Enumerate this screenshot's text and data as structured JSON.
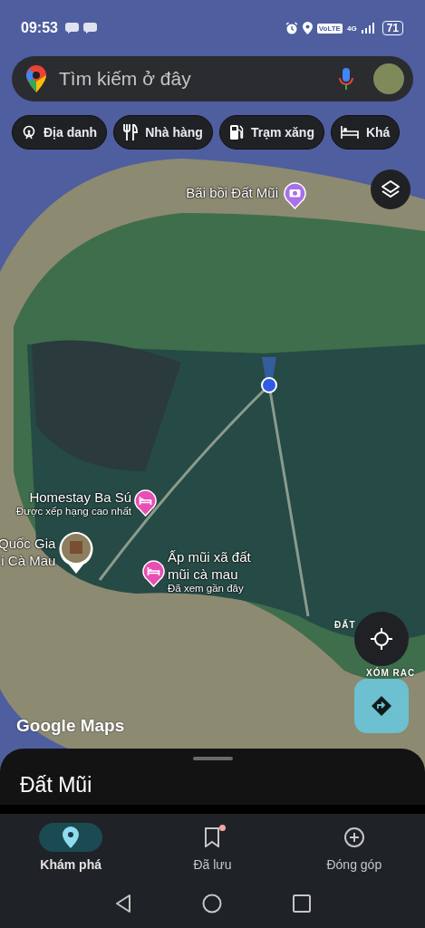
{
  "status_bar": {
    "time": "09:53",
    "network_badge": "VoLTE",
    "network_type": "4G",
    "battery": "71"
  },
  "search": {
    "placeholder": "Tìm kiếm ở đây"
  },
  "chips": [
    {
      "label": "Địa danh",
      "kind": "landmark"
    },
    {
      "label": "Nhà hàng",
      "kind": "restaurant"
    },
    {
      "label": "Trạm xăng",
      "kind": "gas"
    },
    {
      "label": "Khá",
      "kind": "hotel"
    }
  ],
  "map": {
    "places": [
      {
        "lines": [
          "Bãi bồi Đất Mũi"
        ],
        "kind": "camera",
        "color": "#a970e8"
      },
      {
        "lines": [
          "Homestay Ba Sú"
        ],
        "subtitle": "Được xếp hạng cao nhất",
        "kind": "hotel",
        "color": "#e84fb4"
      },
      {
        "lines": [
          "Quốc Gia",
          "i Cà Mau"
        ],
        "kind": "photo"
      },
      {
        "lines": [
          "Ấp mũi xã đất",
          "mũi cà mau"
        ],
        "subtitle": "Đã xem gần đây",
        "kind": "hotel",
        "color": "#e84fb4"
      }
    ],
    "area_labels": [
      "ĐẤT",
      "XÓM RAC"
    ],
    "logo": "Google Maps"
  },
  "sheet": {
    "title": "Đất Mũi"
  },
  "nav": [
    {
      "label": "Khám phá",
      "kind": "explore",
      "selected": true,
      "badge": false
    },
    {
      "label": "Đã lưu",
      "kind": "saved",
      "selected": false,
      "badge": true
    },
    {
      "label": "Đóng góp",
      "kind": "contribute",
      "selected": false,
      "badge": false
    }
  ]
}
